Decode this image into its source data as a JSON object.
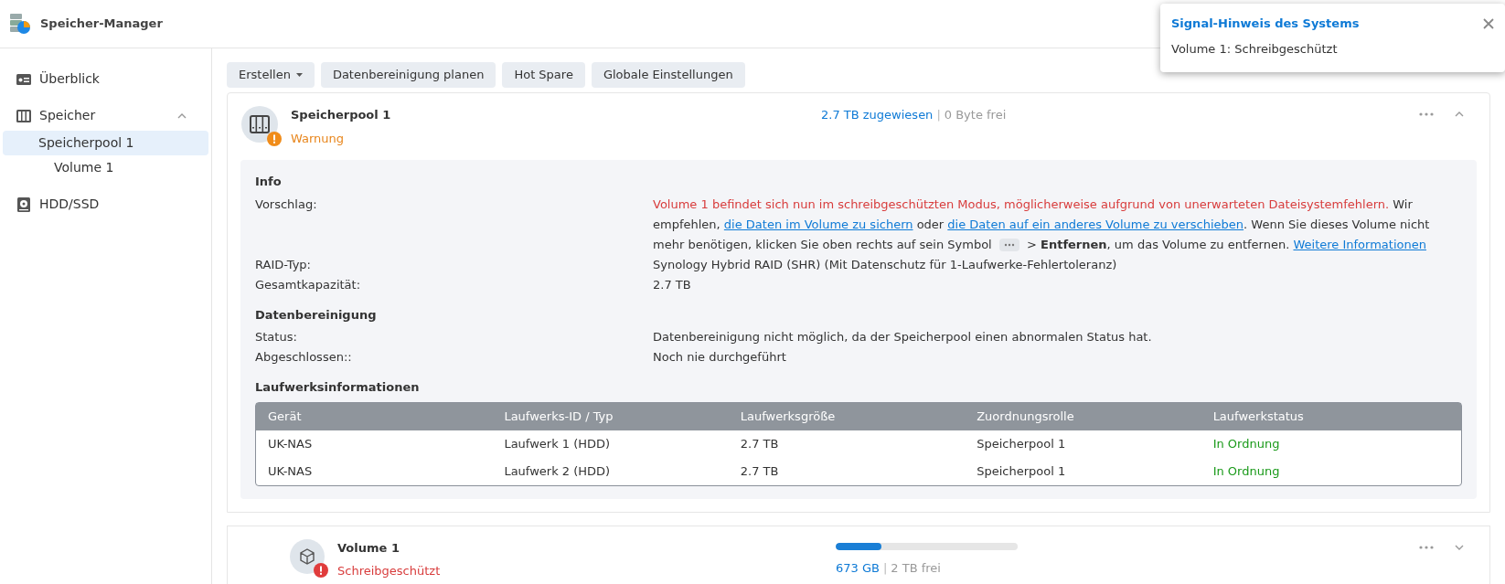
{
  "window": {
    "title": "Speicher-Manager"
  },
  "sidebar": {
    "items": [
      {
        "label": "Überblick",
        "kind": "overview",
        "selected": false
      },
      {
        "label": "Speicher",
        "kind": "storage",
        "selected": false,
        "expanded": true,
        "children": [
          {
            "label": "Speicherpool 1",
            "selected": true,
            "children": [
              {
                "label": "Volume 1",
                "selected": false
              }
            ]
          }
        ]
      },
      {
        "label": "HDD/SSD",
        "kind": "disk",
        "selected": false
      }
    ]
  },
  "toolbar": [
    {
      "label": "Erstellen",
      "dropdown": true
    },
    {
      "label": "Datenbereinigung planen",
      "dropdown": false
    },
    {
      "label": "Hot Spare",
      "dropdown": false
    },
    {
      "label": "Globale Einstellungen",
      "dropdown": false
    }
  ],
  "pool": {
    "title": "Speicherpool 1",
    "status": "Warnung",
    "kind": "warning",
    "allocated": "2.7 TB zugewiesen",
    "separator": "|",
    "free": "0 Byte frei",
    "expanded": true,
    "sections": [
      {
        "title": "Info",
        "rows": [
          {
            "label": "Vorschlag:",
            "segments": [
              {
                "kind": "alert",
                "text": "Volume 1 befindet sich nun im schreibgeschützten Modus, möglicherweise aufgrund von unerwarteten Dateisystemfehlern."
              },
              {
                "kind": "text",
                "text": " Wir empfehlen, "
              },
              {
                "kind": "link",
                "text": "die Daten im Volume zu sichern"
              },
              {
                "kind": "text",
                "text": " oder "
              },
              {
                "kind": "link",
                "text": "die Daten auf ein anderes Volume zu verschieben"
              },
              {
                "kind": "text",
                "text": ". Wenn Sie dieses Volume nicht mehr benötigen, klicken Sie oben rechts auf sein Symbol "
              },
              {
                "kind": "icon"
              },
              {
                "kind": "text",
                "text": " > "
              },
              {
                "kind": "bold",
                "text": "Entfernen"
              },
              {
                "kind": "text",
                "text": ", um das Volume zu entfernen. "
              },
              {
                "kind": "link",
                "text": "Weitere Informationen"
              }
            ]
          },
          {
            "label": "RAID-Typ:",
            "segments": [
              {
                "kind": "text",
                "text": "Synology Hybrid RAID (SHR) (Mit Datenschutz für 1-Laufwerke-Fehlertoleranz)"
              }
            ]
          },
          {
            "label": "Gesamtkapazität:",
            "segments": [
              {
                "kind": "text",
                "text": "2.7 TB"
              }
            ]
          }
        ]
      },
      {
        "title": "Datenbereinigung",
        "rows": [
          {
            "label": "Status:",
            "segments": [
              {
                "kind": "text",
                "text": "Datenbereinigung nicht möglich, da der Speicherpool einen abnormalen Status hat."
              }
            ]
          },
          {
            "label": "Abgeschlossen::",
            "segments": [
              {
                "kind": "text",
                "text": "Noch nie durchgeführt"
              }
            ]
          }
        ]
      }
    ],
    "drives": {
      "title": "Laufwerksinformationen",
      "columns": [
        "Gerät",
        "Laufwerks-ID / Typ",
        "Laufwerksgröße",
        "Zuordnungsrolle",
        "Laufwerkstatus"
      ],
      "rows": [
        {
          "cells": [
            "UK-NAS",
            "Laufwerk 1 (HDD)",
            "2.7 TB",
            "Speicherpool 1",
            "In Ordnung"
          ],
          "status_ok": true
        },
        {
          "cells": [
            "UK-NAS",
            "Laufwerk 2 (HDD)",
            "2.7 TB",
            "Speicherpool 1",
            "In Ordnung"
          ],
          "status_ok": true
        }
      ]
    }
  },
  "volume": {
    "title": "Volume 1",
    "status": "Schreibgeschützt",
    "kind": "error",
    "level": 0.25,
    "used": "673 GB",
    "separator": "|",
    "free": "2 TB frei",
    "expanded": false
  },
  "notification": {
    "title": "Signal-Hinweis des Systems",
    "message": "Volume 1: Schreibgeschützt"
  }
}
